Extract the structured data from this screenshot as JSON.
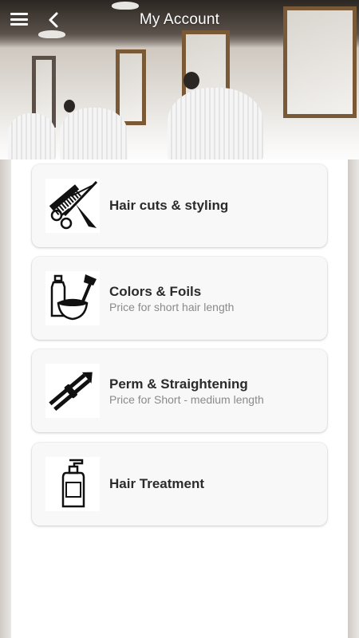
{
  "header": {
    "title": "My Account"
  },
  "services": [
    {
      "name": "Hair cuts & styling",
      "subtitle": "",
      "icon": "scissors-comb-icon"
    },
    {
      "name": "Colors & Foils",
      "subtitle": "Price for short hair length",
      "icon": "hair-dye-icon"
    },
    {
      "name": "Perm & Straightening",
      "subtitle": "Price for Short - medium length",
      "icon": "straightener-icon"
    },
    {
      "name": "Hair Treatment",
      "subtitle": "",
      "icon": "pump-bottle-icon"
    }
  ]
}
